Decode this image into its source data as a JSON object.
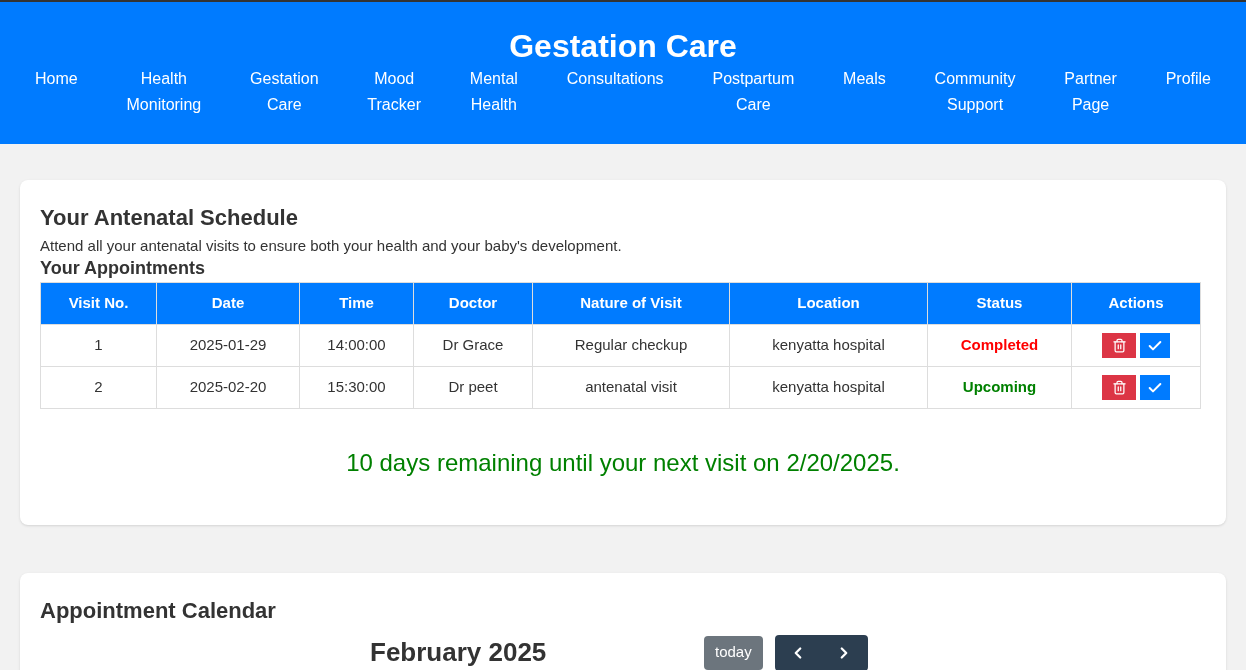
{
  "header": {
    "title": "Gestation Care",
    "nav": [
      {
        "label": "Home"
      },
      {
        "label": "Health Monitoring"
      },
      {
        "label": "Gestation Care"
      },
      {
        "label": "Mood Tracker"
      },
      {
        "label": "Mental Health"
      },
      {
        "label": "Consultations"
      },
      {
        "label": "Postpartum Care"
      },
      {
        "label": "Meals"
      },
      {
        "label": "Community Support"
      },
      {
        "label": "Partner Page"
      },
      {
        "label": "Profile"
      }
    ]
  },
  "schedule": {
    "title": "Your Antenatal Schedule",
    "description": "Attend all your antenatal visits to ensure both your health and your baby's development.",
    "subtitle": "Your Appointments",
    "columns": [
      "Visit No.",
      "Date",
      "Time",
      "Doctor",
      "Nature of Visit",
      "Location",
      "Status",
      "Actions"
    ],
    "rows": [
      {
        "cells": [
          "1",
          "2025-01-29",
          "14:00:00",
          "Dr Grace",
          "Regular checkup",
          "kenyatta hospital"
        ],
        "status": "Completed",
        "color": "#ff0000"
      },
      {
        "cells": [
          "2",
          "2025-02-20",
          "15:30:00",
          "Dr peet",
          "antenatal visit",
          "kenyatta hospital"
        ],
        "status": "Upcoming",
        "color": "#008000"
      }
    ],
    "countdown": "10 days remaining until your next visit on 2/20/2025."
  },
  "calendar": {
    "title": "Appointment Calendar",
    "month": "February 2025",
    "today_button": "today"
  }
}
